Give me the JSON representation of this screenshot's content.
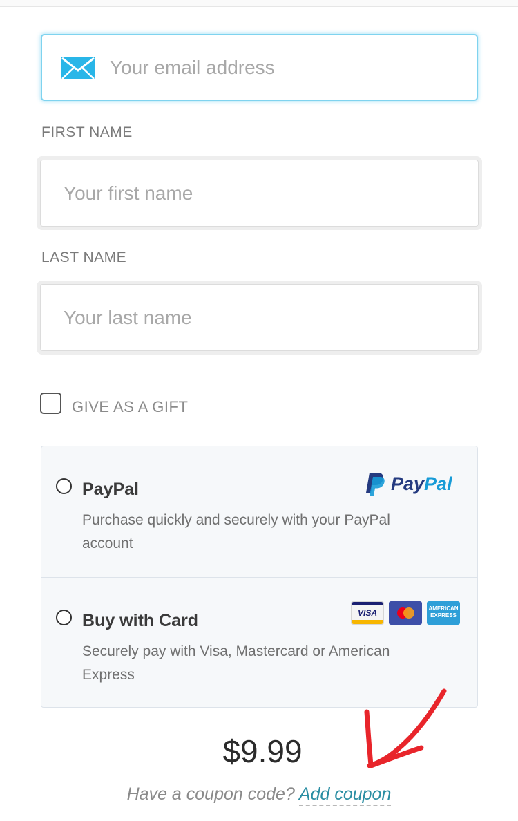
{
  "email": {
    "placeholder": "Your email address",
    "value": ""
  },
  "first_name": {
    "label": "FIRST NAME",
    "placeholder": "Your first name",
    "value": ""
  },
  "last_name": {
    "label": "LAST NAME",
    "placeholder": "Your last name",
    "value": ""
  },
  "gift": {
    "label": "GIVE AS A GIFT",
    "checked": false
  },
  "payment": {
    "options": [
      {
        "title": "PayPal",
        "description": "Purchase quickly and securely with your PayPal account",
        "logo": {
          "pay": "Pay",
          "pal": "Pal"
        },
        "selected": false
      },
      {
        "title": "Buy with Card",
        "description": "Securely pay with Visa, Mastercard or American Express",
        "card_logos": [
          "VISA",
          "Mastercard",
          "AMERICAN EXPRESS"
        ],
        "selected": false
      }
    ]
  },
  "price": "$9.99",
  "coupon": {
    "prompt": "Have a coupon code?",
    "link": "Add coupon"
  },
  "colors": {
    "accent": "#2a8ea3",
    "focus_border": "#7fd3ef",
    "paypal_dark": "#253b80",
    "paypal_light": "#179bd7",
    "annotation": "#e8252b"
  },
  "icons": {
    "email": "envelope-icon",
    "paypal": "paypal-logo",
    "annotation": "red-arrow-annotation"
  }
}
